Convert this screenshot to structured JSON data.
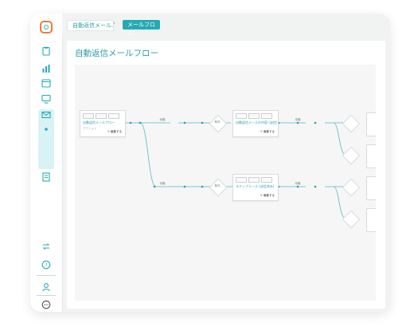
{
  "breadcrumb": {
    "item1": "自動返信メール…",
    "separator": "›",
    "item2": "メールフロー"
  },
  "page": {
    "title": "自動返信メールフロー"
  },
  "sidebar": {
    "icons": [
      "clipboard-icon",
      "bar-chart-icon",
      "calendar-icon",
      "monitor-icon",
      "mail-icon",
      "dot-icon",
      "document-icon",
      "refresh-icon",
      "help-icon",
      "user-icon",
      "chat-icon"
    ]
  },
  "flow": {
    "start_node": {
      "label": "自動返信メールフロー",
      "sub": "アクション",
      "edit": "✎ 編集する"
    },
    "mid_node_top": {
      "label": "自動返信メールの内容 (送信)",
      "edit": "✎ 編集する"
    },
    "mid_node_bottom": {
      "label": "ステップメール (送信済み)",
      "edit": "✎ 編集する"
    },
    "wait_label": "待機",
    "cond_label": "条件"
  },
  "colors": {
    "accent": "#25aab4",
    "brand_orange": "#ef7d3a",
    "edge": "#56b9c3"
  }
}
